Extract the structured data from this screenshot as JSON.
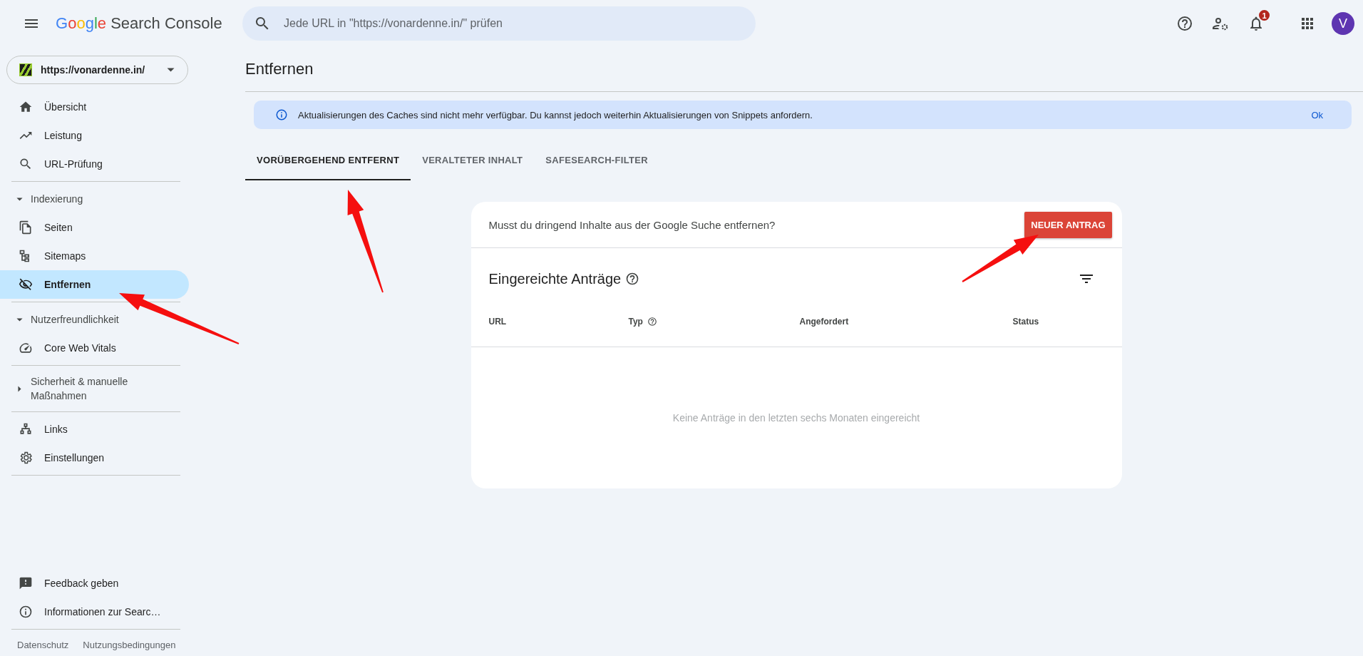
{
  "header": {
    "logo_text": "Google",
    "product_name": "Search Console",
    "search": {
      "placeholder": "Jede URL in \"https://vonardenne.in/\" prüfen"
    },
    "notification_count": "1",
    "avatar_letter": "V"
  },
  "property": {
    "url": "https://vonardenne.in/"
  },
  "sidebar": {
    "sections": [
      {
        "items": [
          {
            "label": "Übersicht",
            "selected": false
          },
          {
            "label": "Leistung",
            "selected": false
          },
          {
            "label": "URL-Prüfung",
            "selected": false
          }
        ]
      },
      {
        "group": {
          "label": "Indexierung",
          "expanded": true
        },
        "items": [
          {
            "label": "Seiten",
            "selected": false
          },
          {
            "label": "Sitemaps",
            "selected": false
          },
          {
            "label": "Entfernen",
            "selected": true
          }
        ]
      },
      {
        "group": {
          "label": "Nutzerfreundlichkeit",
          "expanded": true
        },
        "items": [
          {
            "label": "Core Web Vitals",
            "selected": false
          }
        ]
      },
      {
        "group": {
          "label": "Sicherheit & manuelle Maßnahmen",
          "expanded": false
        }
      },
      {
        "items": [
          {
            "label": "Links",
            "selected": false
          },
          {
            "label": "Einstellungen",
            "selected": false
          }
        ]
      }
    ],
    "bottom_items": [
      {
        "label": "Feedback geben"
      },
      {
        "label": "Informationen zur Searc…"
      }
    ],
    "footer_links": [
      "Datenschutz",
      "Nutzungsbedingungen"
    ]
  },
  "page": {
    "title": "Entfernen",
    "banner": {
      "text": "Aktualisierungen des Caches sind nicht mehr verfügbar. Du kannst jedoch weiterhin Aktualisierungen von Snippets anfordern.",
      "action": "Ok"
    },
    "tabs": [
      {
        "label": "VORÜBERGEHEND ENTFERNT",
        "selected": true
      },
      {
        "label": "VERALTETER INHALT",
        "selected": false
      },
      {
        "label": "SAFESEARCH-FILTER",
        "selected": false
      }
    ],
    "card": {
      "prompt": "Musst du dringend Inhalte aus der Google Suche entfernen?",
      "button": "NEUER ANTRAG",
      "heading": "Eingereichte Anträge",
      "columns": [
        {
          "label": "URL",
          "help": false
        },
        {
          "label": "Typ",
          "help": true
        },
        {
          "label": "Angefordert",
          "help": false
        },
        {
          "label": "Status",
          "help": false
        }
      ],
      "empty_text": "Keine Anträge in den letzten sechs Monaten eingereicht"
    }
  }
}
